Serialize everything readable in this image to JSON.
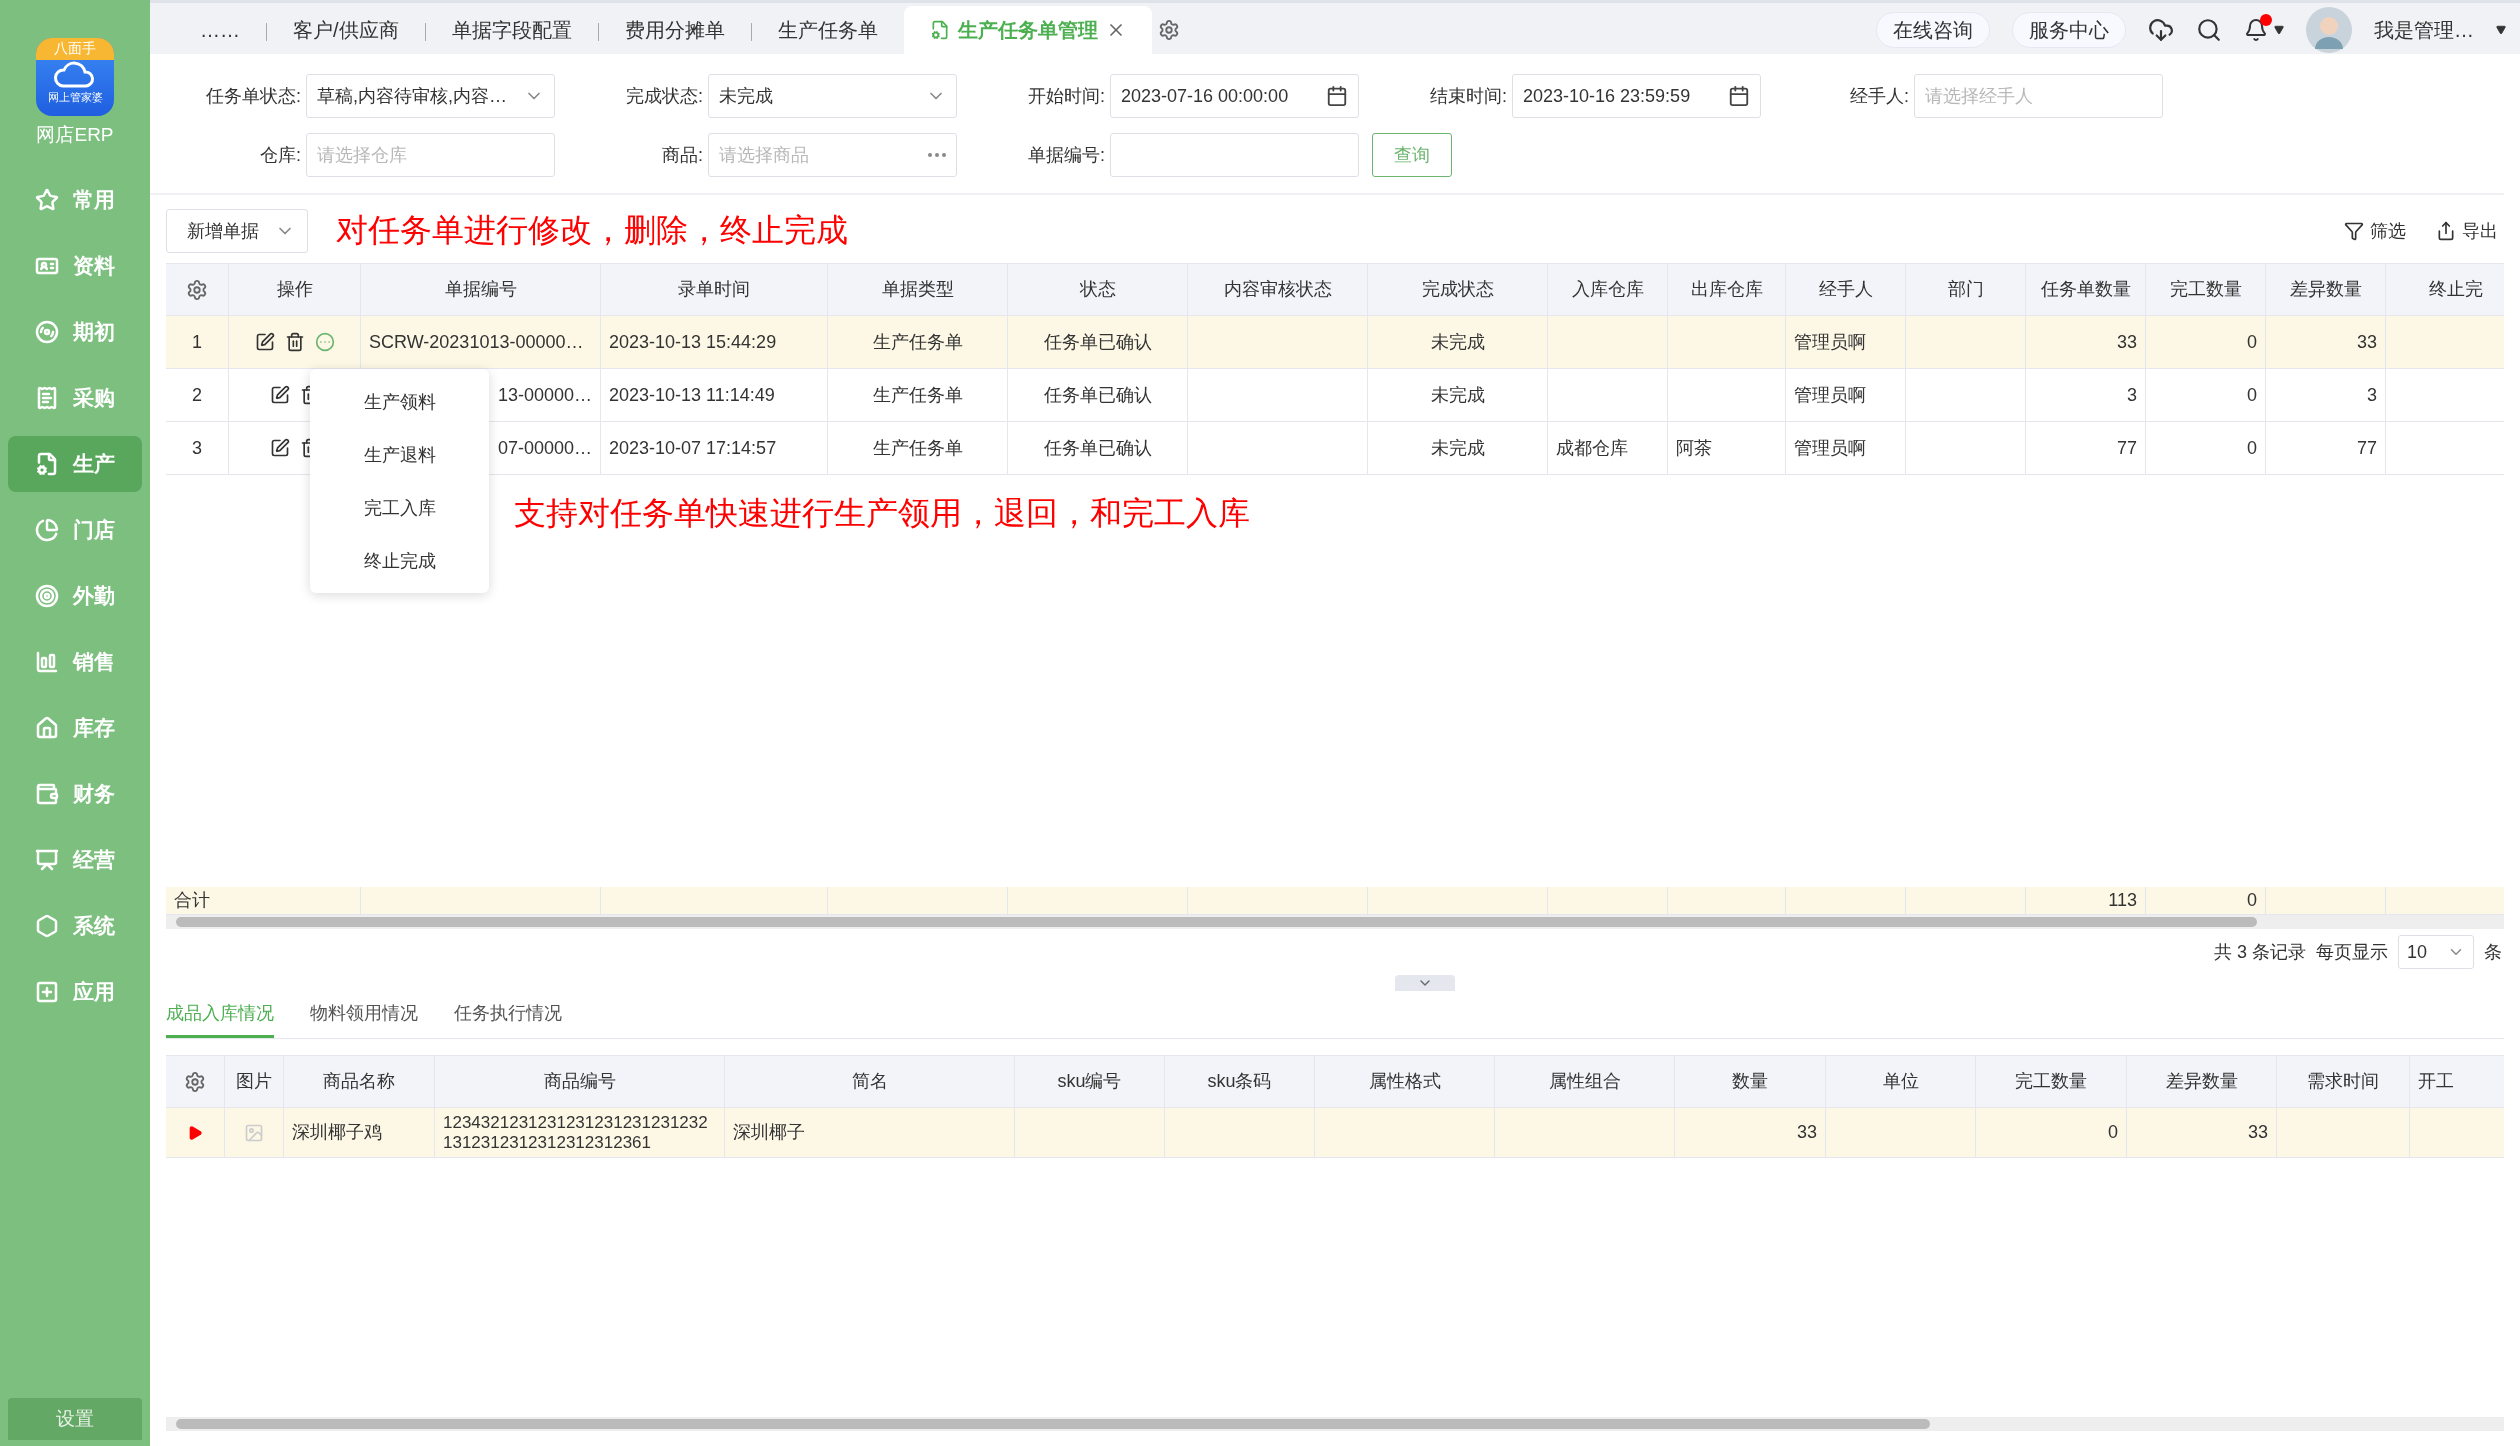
{
  "sidebar": {
    "logo": {
      "top_text": "八面手",
      "bottom_text": "网上管家婆"
    },
    "app_name": "网店ERP",
    "items": [
      {
        "label": "常用",
        "selected": false
      },
      {
        "label": "资料",
        "selected": false
      },
      {
        "label": "期初",
        "selected": false
      },
      {
        "label": "采购",
        "selected": false
      },
      {
        "label": "生产",
        "selected": true
      },
      {
        "label": "门店",
        "selected": false
      },
      {
        "label": "外勤",
        "selected": false
      },
      {
        "label": "销售",
        "selected": false
      },
      {
        "label": "库存",
        "selected": false
      },
      {
        "label": "财务",
        "selected": false
      },
      {
        "label": "经营",
        "selected": false
      },
      {
        "label": "系统",
        "selected": false
      },
      {
        "label": "应用",
        "selected": false
      }
    ],
    "settings": "设置"
  },
  "tabs": [
    {
      "label": "……",
      "selected": false
    },
    {
      "label": "客户/供应商",
      "selected": false
    },
    {
      "label": "单据字段配置",
      "selected": false
    },
    {
      "label": "费用分摊单",
      "selected": false
    },
    {
      "label": "生产任务单",
      "selected": false
    },
    {
      "label": "生产任务单管理",
      "selected": true
    }
  ],
  "header": {
    "links": [
      "在线咨询",
      "服务中心"
    ],
    "notifications_unread": true,
    "user": "我是管理…"
  },
  "filters": [
    {
      "label": "任务单状态:",
      "kind": "select",
      "value": "草稿,内容待审核,内容…"
    },
    {
      "label": "完成状态:",
      "kind": "select",
      "value": "未完成"
    },
    {
      "label": "开始时间:",
      "kind": "date",
      "value": "2023-07-16 00:00:00"
    },
    {
      "label": "结束时间:",
      "kind": "date",
      "value": "2023-10-16 23:59:59"
    },
    {
      "label": "经手人:",
      "kind": "input",
      "placeholder": "请选择经手人"
    },
    {
      "label": "仓库:",
      "kind": "input",
      "placeholder": "请选择仓库"
    },
    {
      "label": "商品:",
      "kind": "picker",
      "placeholder": "请选择商品"
    },
    {
      "label": "单据编号:",
      "kind": "input"
    }
  ],
  "query_button": "查询",
  "toolbar": {
    "new_button": "新增单据",
    "note": "对任务单进行修改，删除，终止完成",
    "actions": [
      "筛选",
      "导出"
    ]
  },
  "table": {
    "ops_header": "操作",
    "columns": [
      {
        "label": "单据编号",
        "kind": "left"
      },
      {
        "label": "录单时间",
        "kind": "left"
      },
      {
        "label": "单据类型",
        "kind": "center"
      },
      {
        "label": "状态",
        "kind": "center"
      },
      {
        "label": "内容审核状态",
        "kind": "center"
      },
      {
        "label": "完成状态",
        "kind": "center"
      },
      {
        "label": "入库仓库",
        "kind": "left"
      },
      {
        "label": "出库仓库",
        "kind": "left"
      },
      {
        "label": "经手人",
        "kind": "left"
      },
      {
        "label": "部门",
        "kind": "center"
      },
      {
        "label": "任务单数量",
        "kind": "number"
      },
      {
        "label": "完工数量",
        "kind": "number"
      },
      {
        "label": "差异数量",
        "kind": "number"
      },
      {
        "label": "终止完",
        "kind": "center"
      }
    ],
    "rows": [
      {
        "index": "1",
        "selected": true,
        "menu_open": true,
        "cells": [
          "SCRW-20231013-00000…",
          "2023-10-13 15:44:29",
          "生产任务单",
          "任务单已确认",
          "",
          "未完成",
          "",
          "",
          "管理员啊",
          "",
          "33",
          "0",
          "33",
          ""
        ]
      },
      {
        "index": "2",
        "selected": false,
        "menu_open": false,
        "cells": [
          "13-00000…",
          "2023-10-13 11:14:49",
          "生产任务单",
          "任务单已确认",
          "",
          "未完成",
          "",
          "",
          "管理员啊",
          "",
          "3",
          "0",
          "3",
          ""
        ]
      },
      {
        "index": "3",
        "selected": false,
        "menu_open": false,
        "cells": [
          "07-00000…",
          "2023-10-07 17:14:57",
          "生产任务单",
          "任务单已确认",
          "",
          "未完成",
          "成都仓库",
          "阿茶",
          "管理员啊",
          "",
          "77",
          "0",
          "77",
          ""
        ]
      }
    ],
    "row_menu": [
      "生产领料",
      "生产退料",
      "完工入库",
      "终止完成"
    ],
    "note": "支持对任务单快速进行生产领用，退回，和完工入库",
    "totals": {
      "label": "合计",
      "task_quantity": "113",
      "completed_quantity": "0"
    }
  },
  "pagination": {
    "summary": "共 3 条记录",
    "per_page_label": "每页显示",
    "per_page": "10",
    "unit": "条"
  },
  "detail_tabs": [
    {
      "label": "成品入库情况",
      "selected": true
    },
    {
      "label": "物料领用情况",
      "selected": false
    },
    {
      "label": "任务执行情况",
      "selected": false
    }
  ],
  "detail_table": {
    "image_header": "图片",
    "columns": [
      {
        "label": "商品名称",
        "kind": "left"
      },
      {
        "label": "商品编号",
        "kind": "left"
      },
      {
        "label": "简名",
        "kind": "left"
      },
      {
        "label": "sku编号",
        "kind": "center"
      },
      {
        "label": "sku条码",
        "kind": "center"
      },
      {
        "label": "属性格式",
        "kind": "center"
      },
      {
        "label": "属性组合",
        "kind": "center"
      },
      {
        "label": "数量",
        "kind": "number"
      },
      {
        "label": "单位",
        "kind": "center"
      },
      {
        "label": "完工数量",
        "kind": "number"
      },
      {
        "label": "差异数量",
        "kind": "number"
      },
      {
        "label": "需求时间",
        "kind": "center"
      },
      {
        "label": "开工",
        "kind": "left"
      }
    ],
    "rows": [
      {
        "selected": true,
        "cells": [
          "深圳椰子鸡",
          "12343212312312312312312312321312312312312312312361",
          "深圳椰子",
          "",
          "",
          "",
          "",
          "33",
          "",
          "0",
          "33",
          "",
          ""
        ]
      }
    ]
  }
}
